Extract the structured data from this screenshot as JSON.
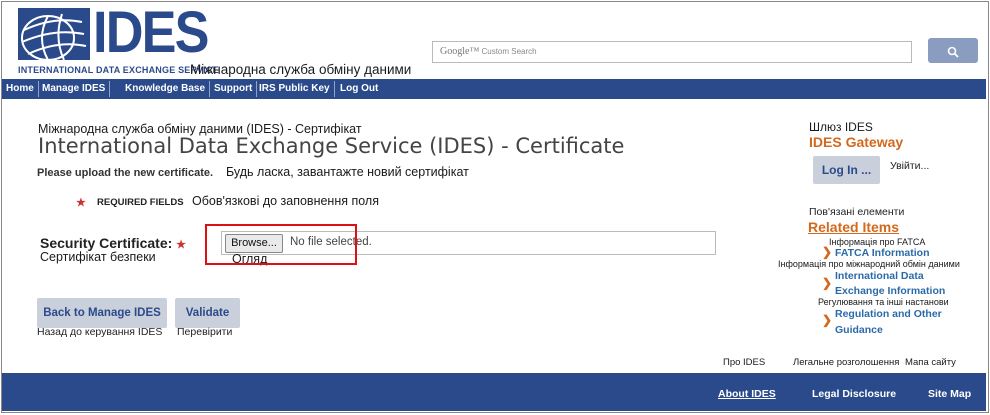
{
  "header": {
    "logo_text": "IDES",
    "logo_subtitle": "INTERNATIONAL DATA EXCHANGE SERVICE",
    "logo_ua": "Міжнародна служба обміну даними",
    "search_placeholder_brand": "Google™",
    "search_placeholder_text": "Custom Search",
    "search_button_icon": "search-icon"
  },
  "nav": {
    "items": [
      "Home",
      "Manage IDES",
      "Knowledge Base",
      "Support",
      "IRS Public Key",
      "Log Out"
    ]
  },
  "main": {
    "title_ua": "Міжнародна служба обміну даними (IDES) - Сертифікат",
    "title": "International Data Exchange Service (IDES) - Certificate",
    "upload_instruction": "Please upload the new certificate.",
    "upload_instruction_ua": "Будь ласка, завантажте новий сертифікат",
    "required_star": "★",
    "required_label": "REQUIRED FIELDS",
    "required_label_ua": "Обов'язкові до заповнення поля",
    "security_label": "Security Certificate:",
    "security_star": "★",
    "security_label_ua": "Сертифікат безпеки",
    "browse_label": "Browse...",
    "browse_label_ua": "Огляд",
    "no_file_text": "No file selected.",
    "back_button": "Back to Manage IDES",
    "back_button_ua": "Назад до керування IDES",
    "validate_button": "Validate",
    "validate_button_ua": "Перевірити"
  },
  "sidebar": {
    "gateway_ua": "Шлюз IDES",
    "gateway_title": "IDES Gateway",
    "login_button": "Log In ...",
    "login_ua": "Увійти...",
    "related_ua": "Пов'язані елементи",
    "related_title": "Related Items",
    "links": [
      {
        "ua": "Інформація про FATCA",
        "label_lines": [
          "FATCA Information"
        ]
      },
      {
        "ua": "Інформація про міжнародний обмін даними",
        "label_lines": [
          "International Data",
          "Exchange Information"
        ]
      },
      {
        "ua": "Регулювання та інші настанови",
        "label_lines": [
          "Regulation and Other",
          "Guidance"
        ]
      }
    ]
  },
  "footer": {
    "about_ua": "Про IDES",
    "legal_ua": "Легальне розголошення",
    "sitemap_ua": "Мапа сайту",
    "about": "About IDES",
    "legal": "Legal Disclosure",
    "sitemap": "Site Map"
  },
  "colors": {
    "brand_blue": "#2b4a8b",
    "link_orange": "#d2691e",
    "highlight_red": "#dd1111",
    "button_grey": "#c9cfdb"
  }
}
